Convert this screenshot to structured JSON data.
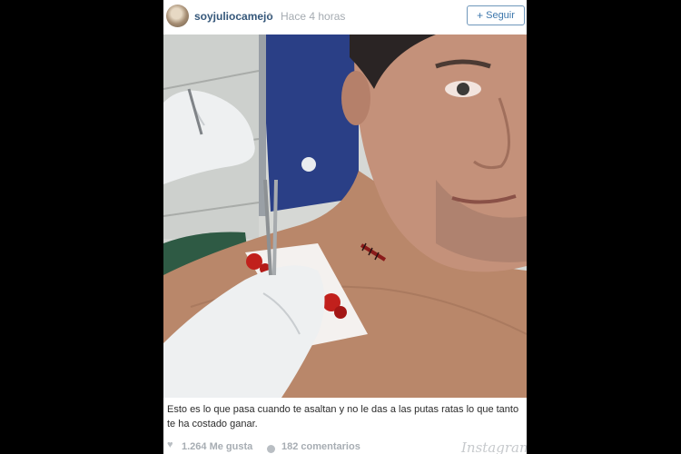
{
  "header": {
    "username": "soyjuliocamejo",
    "separator": "•",
    "timestamp": "Hace 4 horas",
    "follow_icon": "+",
    "follow_label": "Seguir"
  },
  "post": {
    "caption": "Esto es lo que pasa cuando te asaltan y no le das a las putas ratas lo que tanto te ha costado ganar."
  },
  "footer": {
    "likes_icon": "♥",
    "likes": "1.264 Me gusta",
    "comments": "182 comentarios",
    "brand": "Instagram"
  },
  "colors": {
    "background": "#000000",
    "username": "#35577a",
    "follow_border": "#6f97bb",
    "cabinet_blue": "#2a3f86"
  }
}
